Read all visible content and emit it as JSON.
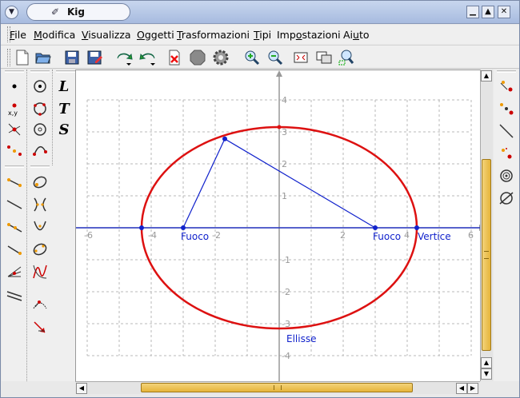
{
  "window": {
    "title": "Kig"
  },
  "menu": [
    {
      "key": "file",
      "pre": "",
      "u": "F",
      "post": "ile"
    },
    {
      "key": "modifica",
      "pre": "",
      "u": "M",
      "post": "odifica"
    },
    {
      "key": "visualizza",
      "pre": "",
      "u": "V",
      "post": "isualizza"
    },
    {
      "key": "oggetti",
      "pre": "",
      "u": "O",
      "post": "ggetti"
    },
    {
      "key": "trasformazioni",
      "pre": "",
      "u": "T",
      "post": "rasformazioni"
    },
    {
      "key": "tipi",
      "pre": "",
      "u": "T",
      "post": "ipi"
    },
    {
      "key": "impostazioni",
      "pre": "Imp",
      "u": "o",
      "post": "stazioni"
    },
    {
      "key": "aiuto",
      "pre": "Ai",
      "u": "u",
      "post": "to"
    }
  ],
  "tool_letters": [
    "L",
    "T",
    "S"
  ],
  "left_small_text": "x,y",
  "plot": {
    "xlim": [
      -6,
      6
    ],
    "ylim": [
      -4,
      4
    ],
    "x_ticks": [
      "-6",
      "-4",
      "-2",
      "2",
      "4",
      "6"
    ],
    "y_ticks": [
      "4",
      "3",
      "2",
      "1",
      "-1",
      "-2",
      "-3",
      "-4"
    ],
    "ellipse": {
      "center": [
        0,
        0
      ],
      "a": 4.3,
      "b": 3.15,
      "color": "#dd1111"
    },
    "foci": [
      [
        -3,
        0
      ],
      [
        3,
        0
      ]
    ],
    "point_on_ellipse": [
      -1.7,
      2.78
    ],
    "vertex": [
      4.3,
      0
    ],
    "labels": {
      "focus1": "Fuoco",
      "focus2": "Fuoco",
      "vertex": "Vertice",
      "ellipse": "Ellisse"
    },
    "line_color": "#1122cc",
    "grid": true
  },
  "icons": {
    "toolbar": [
      "new-icon",
      "open-icon",
      "save-icon",
      "save-as-icon",
      "undo-icon",
      "redo-icon",
      "delete-icon",
      "stop-icon",
      "run-macro-icon",
      "zoom-in-icon",
      "zoom-out-icon",
      "fit-to-page-icon",
      "full-screen-icon",
      "zoom-area-icon"
    ]
  }
}
